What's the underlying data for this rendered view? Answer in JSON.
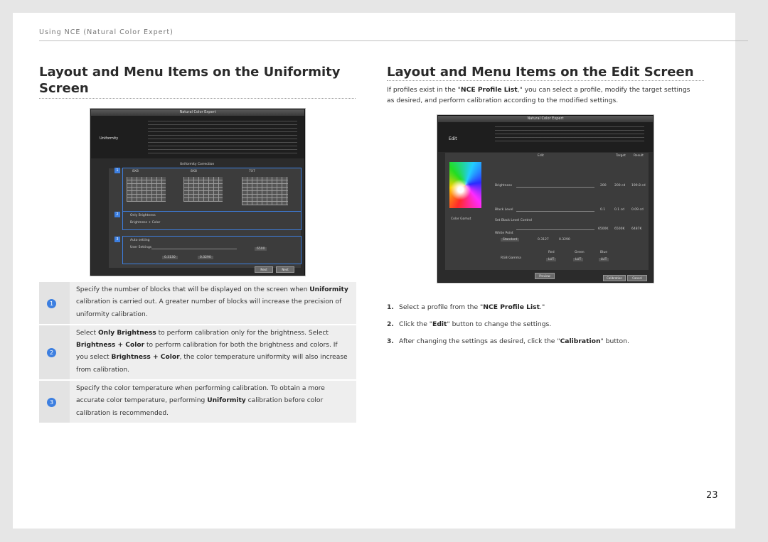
{
  "header": "Using NCE (Natural Color Expert)",
  "left": {
    "title": "Layout and Menu Items on the Uniformity Screen",
    "screenshot": {
      "window_title": "Natural Color Expert",
      "side_label": "Uniformity",
      "section_label": "Uniformity Correction",
      "options_grid": [
        "8X8",
        "8X8",
        "7X7"
      ],
      "options_mode": [
        "Only Brightness",
        "Brightness + Color"
      ],
      "options_temp": [
        "Auto setting",
        "User Settings"
      ],
      "temp_value": "6500",
      "xy_x": "0.3130",
      "xy_y": "0.3290",
      "buttons": [
        "Next",
        "Next"
      ],
      "markers": [
        "1",
        "2",
        "3"
      ]
    },
    "rows": [
      {
        "num": "1",
        "lines": [
          [
            "Specify the number of blocks that will be displayed on the screen when ",
            {
              "b": "Uniformity"
            }
          ],
          [
            "calibration is carried out. A greater number of blocks will increase the precision of"
          ],
          [
            "uniformity calibration."
          ]
        ]
      },
      {
        "num": "2",
        "lines": [
          [
            "Select ",
            {
              "b": "Only Brightness"
            },
            " to perform calibration only for the brightness. Select"
          ],
          [
            {
              "b": "Brightness + Color"
            },
            " to perform calibration for both the brightness and colors. If"
          ],
          [
            "you select ",
            {
              "b": "Brightness + Color"
            },
            ", the color temperature uniformity will also increase"
          ],
          [
            "from calibration."
          ]
        ]
      },
      {
        "num": "3",
        "lines": [
          [
            "Specify the color temperature when performing calibration. To obtain a more"
          ],
          [
            "accurate color temperature, performing ",
            {
              "b": "Uniformity"
            },
            " calibration before color"
          ],
          [
            "calibration is recommended."
          ]
        ]
      }
    ]
  },
  "right": {
    "title": "Layout and Menu Items on the Edit Screen",
    "intro_lines": [
      [
        "If profiles exist in the \"",
        {
          "b": "NCE Profile List"
        },
        ",\" you can select a profile, modify the target settings"
      ],
      [
        "as desired, and perform calibration according to the modified settings."
      ]
    ],
    "screenshot": {
      "window_title": "Natural Color Expert",
      "side_label": "Edit",
      "tab_labels": [
        "Edit",
        "Target",
        "Result"
      ],
      "rows": [
        "Brightness",
        "Black Level",
        "Set Black Level Control",
        "White Point",
        "RGB Gamma"
      ],
      "color_gamut_label": "Color Gamut",
      "gamma_cols": [
        "Red",
        "Green",
        "Blue"
      ],
      "gamma_vals": [
        "LUT",
        "LUT",
        "LUT"
      ],
      "preview_btn": "Preview",
      "bottom_buttons": [
        "Calibration",
        "Cancel"
      ],
      "values": [
        "200",
        "200 cd",
        "199.8 cd",
        "0.1",
        "0.1 cd",
        "0.09 cd",
        "6500K",
        "6500K",
        "6487K",
        "0.3127",
        "0.3290",
        "Standard"
      ]
    },
    "steps": [
      {
        "n": "1.",
        "parts": [
          "Select a profile from the \"",
          {
            "b": "NCE Profile List"
          },
          ".\""
        ]
      },
      {
        "n": "2.",
        "parts": [
          "Click the \"",
          {
            "b": "Edit"
          },
          "\" button to change the settings."
        ]
      },
      {
        "n": "3.",
        "parts": [
          "After changing the settings as desired, click the \"",
          {
            "b": "Calibration"
          },
          "\" button."
        ]
      }
    ]
  },
  "page_number": "23",
  "colors": {
    "accent": "#3d7fe0",
    "row_bg": "#eeeeee",
    "num_bg": "#e3e3e3"
  }
}
